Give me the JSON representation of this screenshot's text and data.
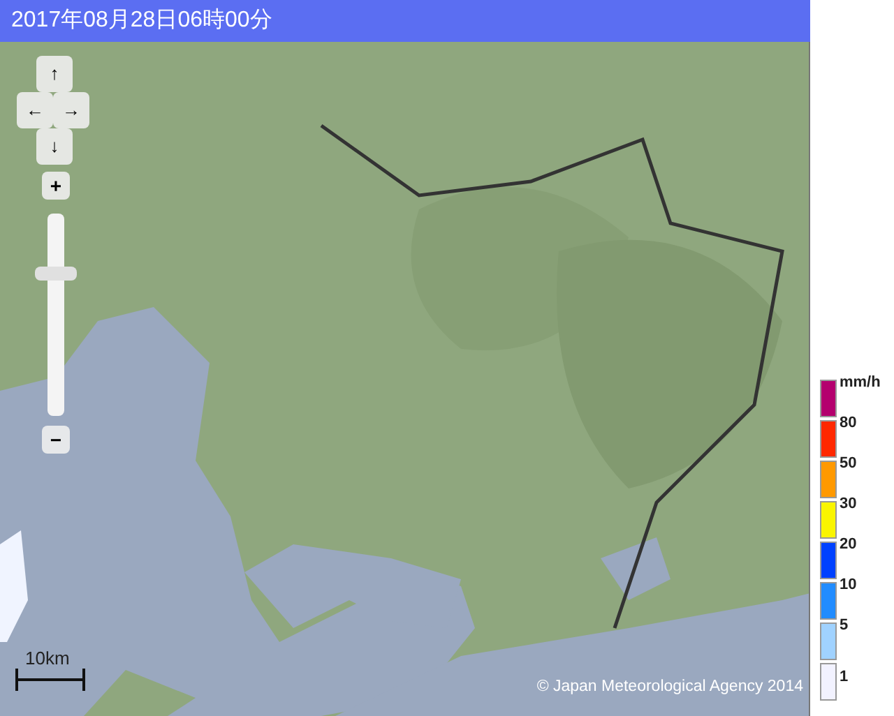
{
  "title": "2017年08月28日06時00分",
  "navigation": {
    "buttons": [
      {
        "kind": "up",
        "label": "↑"
      },
      {
        "kind": "left",
        "label": "←"
      },
      {
        "kind": "right",
        "label": "→"
      },
      {
        "kind": "down",
        "label": "↓"
      }
    ]
  },
  "zoom": {
    "in_label": "+",
    "out_label": "−",
    "level": 0.72
  },
  "scale": {
    "label": "10km"
  },
  "copyright": "© Japan Meteorological Agency 2014",
  "legend": [
    {
      "color": "#b4006e",
      "label": "mm/h"
    },
    {
      "color": "#ff2800",
      "label": "80"
    },
    {
      "color": "#ff9900",
      "label": "50"
    },
    {
      "color": "#faf500",
      "label": "30"
    },
    {
      "color": "#0041ff",
      "label": "20"
    },
    {
      "color": "#218cff",
      "label": "10"
    },
    {
      "color": "#a0d2ff",
      "label": "5"
    },
    {
      "color": "#f2f2ff",
      "label": "1"
    }
  ]
}
